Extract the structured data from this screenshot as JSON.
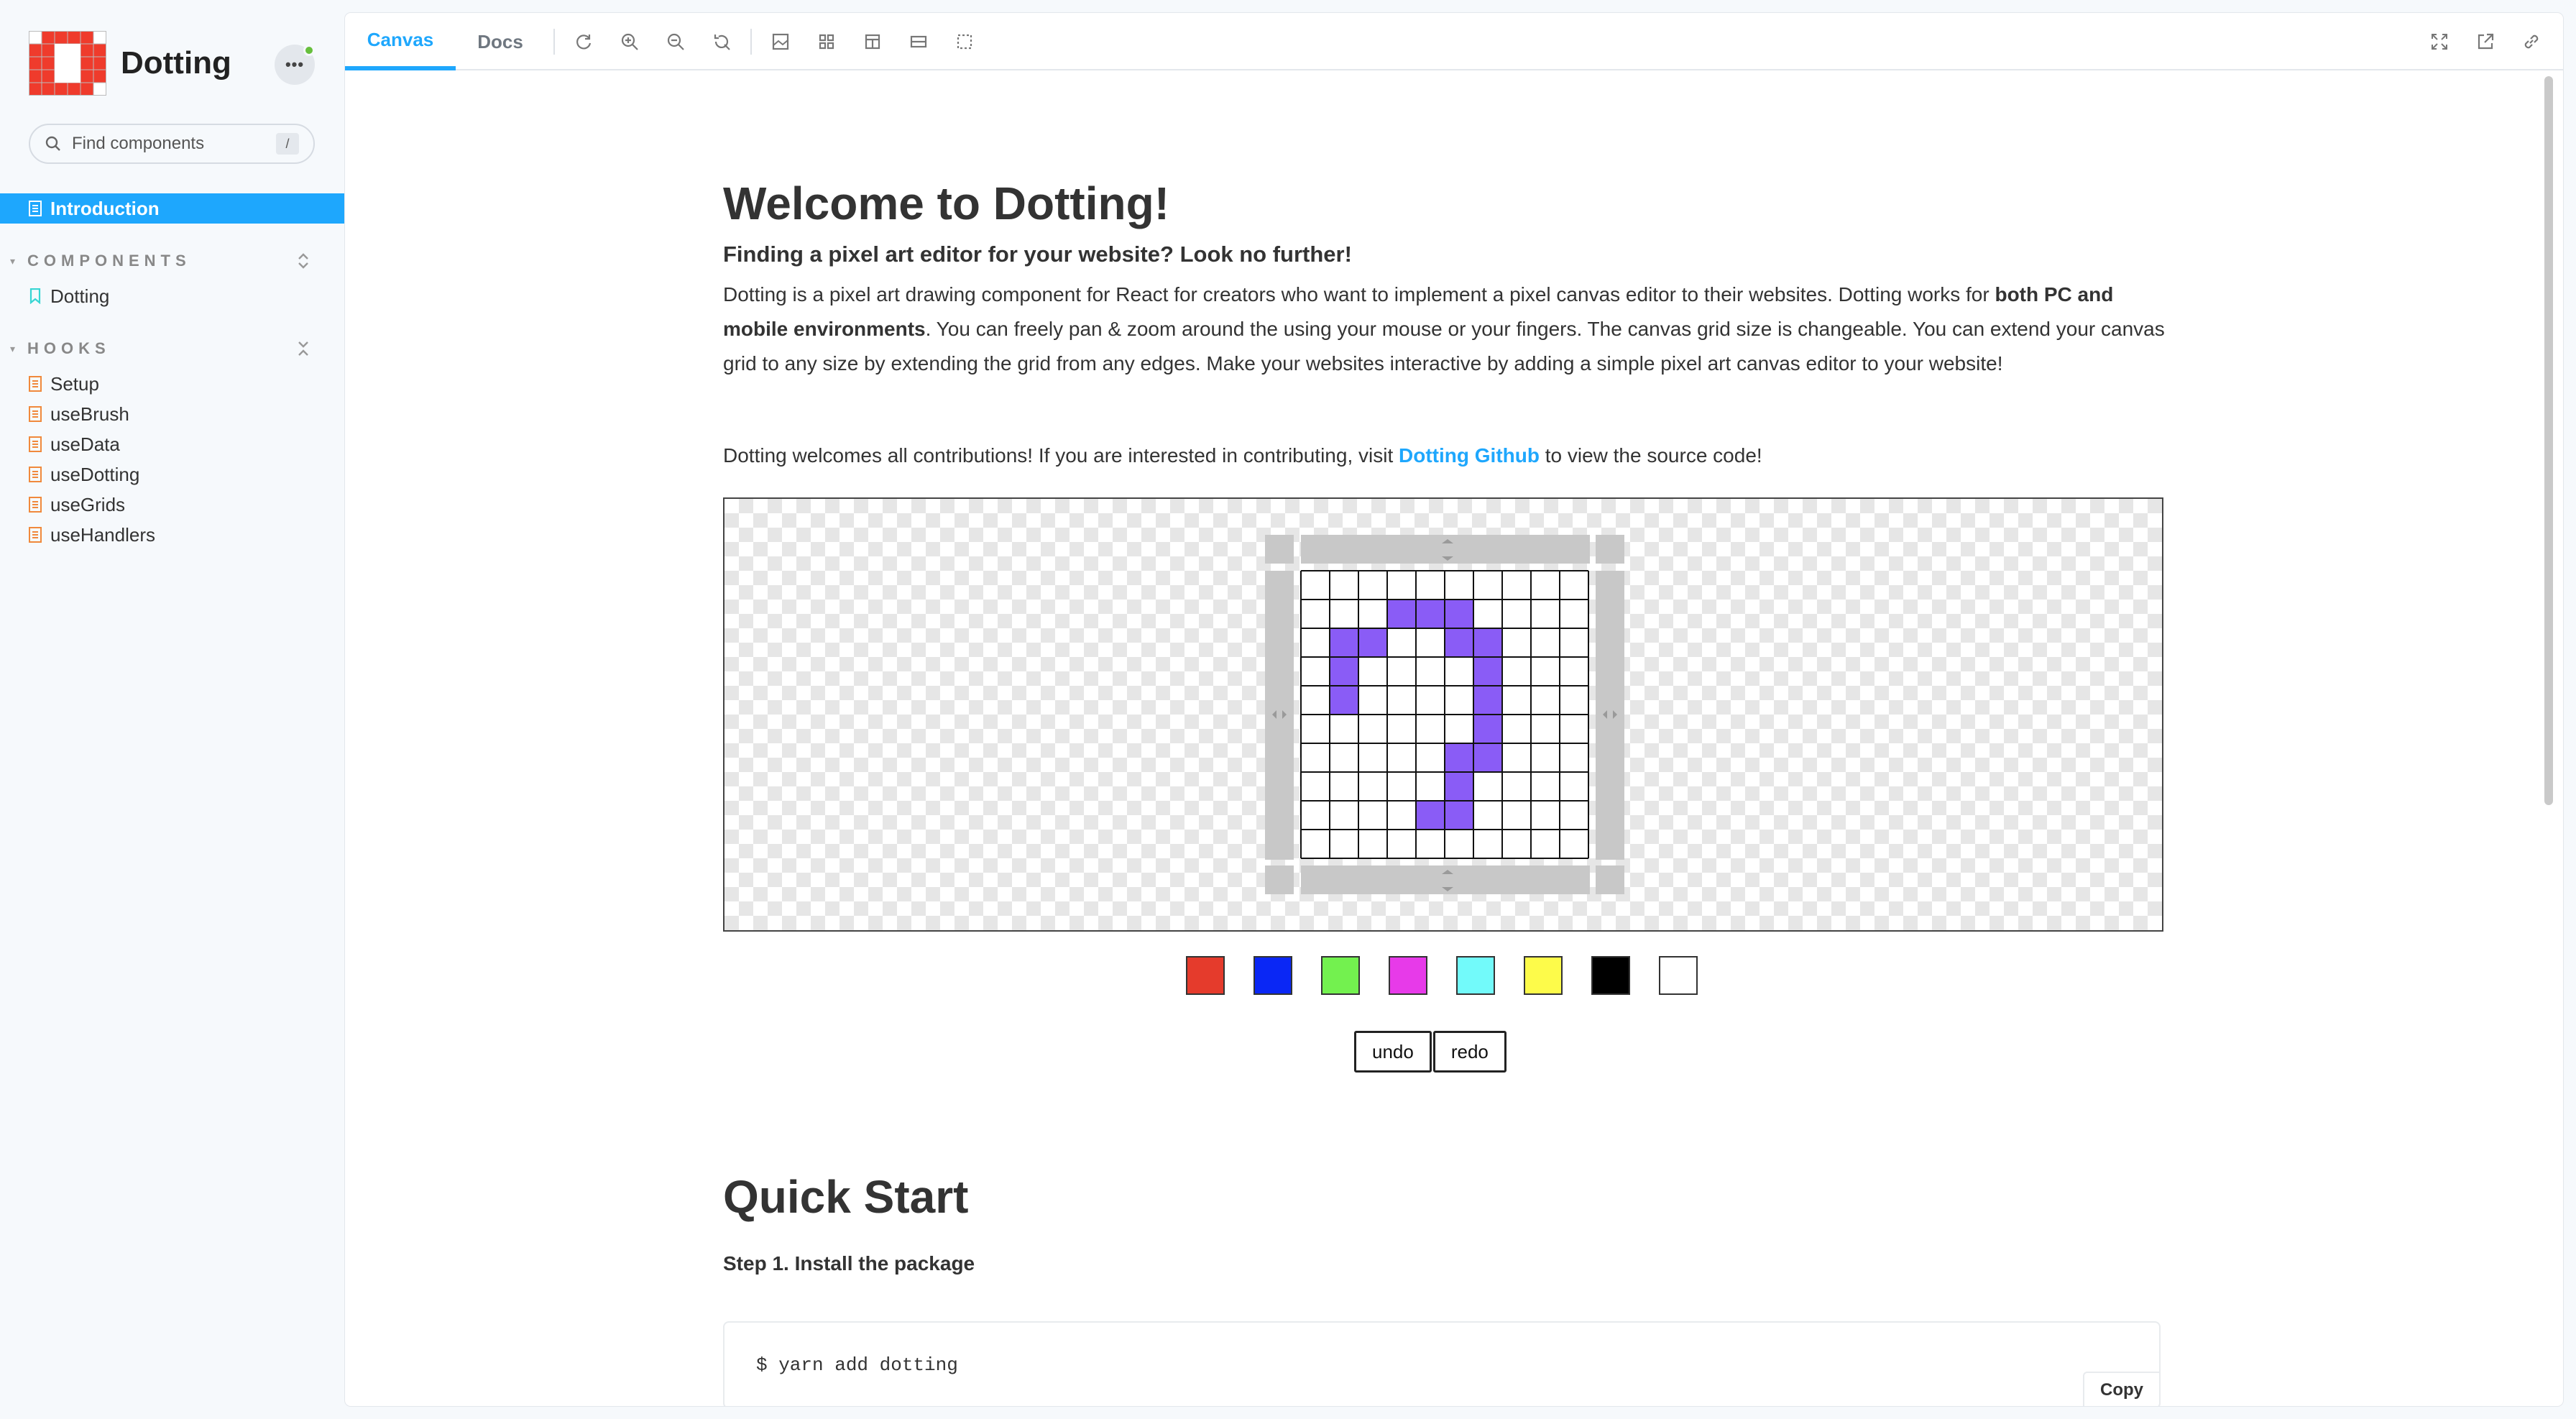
{
  "sidebar": {
    "brand_name": "Dotting",
    "search_placeholder": "Find components",
    "search_shortcut": "/",
    "active_item": "Introduction",
    "sections": [
      {
        "title": "COMPONENTS",
        "items": [
          "Dotting"
        ]
      },
      {
        "title": "HOOKS",
        "items": [
          "Setup",
          "useBrush",
          "useData",
          "useDotting",
          "useGrids",
          "useHandlers"
        ]
      }
    ]
  },
  "toolbar": {
    "tabs": [
      "Canvas",
      "Docs"
    ],
    "active_tab": "Canvas",
    "tools": [
      "reload-icon",
      "zoom-in-icon",
      "zoom-out-icon",
      "reset-zoom-icon",
      "background-icon",
      "grid-icon",
      "measure-icon",
      "outline-icon",
      "viewport-icon"
    ],
    "right_tools": [
      "fullscreen-icon",
      "open-new-tab-icon",
      "copy-link-icon"
    ]
  },
  "content": {
    "title": "Welcome to Dotting!",
    "subtitle": "Finding a pixel art editor for your website? Look no further!",
    "intro_1": "Dotting is a pixel art drawing component for React for creators who want to implement a pixel canvas editor to their websites. Dotting works for ",
    "intro_bold": "both PC and mobile environments",
    "intro_2": ". You can freely pan & zoom around the using your mouse or your fingers. The canvas grid size is changeable. You can extend your canvas grid to any size by extending the grid from any edges. Make your websites interactive by adding a simple pixel art canvas editor to your website!",
    "contrib_1": "Dotting welcomes all contributions! If you are interested in contributing, visit ",
    "contrib_link": "Dotting Github",
    "contrib_2": " to view the source code!",
    "undo_label": "undo",
    "redo_label": "redo",
    "quickstart_title": "Quick Start",
    "step1": "Step 1. Install the package",
    "code_prompt": "$ yarn add dotting",
    "copy_label": "Copy"
  },
  "palette": [
    "#e53b2c",
    "#0a27f5",
    "#73f14f",
    "#e73ae9",
    "#72fafa",
    "#fdfb4a",
    "#000000",
    "#ffffff"
  ],
  "pixel_grid": {
    "cols": 10,
    "rows": 10,
    "fill_color": "#8a5cf6",
    "filled": [
      [
        1,
        3
      ],
      [
        1,
        4
      ],
      [
        1,
        5
      ],
      [
        2,
        1
      ],
      [
        2,
        2
      ],
      [
        2,
        5
      ],
      [
        2,
        6
      ],
      [
        3,
        1
      ],
      [
        3,
        6
      ],
      [
        4,
        1
      ],
      [
        4,
        6
      ],
      [
        5,
        6
      ],
      [
        6,
        5
      ],
      [
        6,
        6
      ],
      [
        7,
        5
      ],
      [
        8,
        4
      ],
      [
        8,
        5
      ]
    ]
  }
}
